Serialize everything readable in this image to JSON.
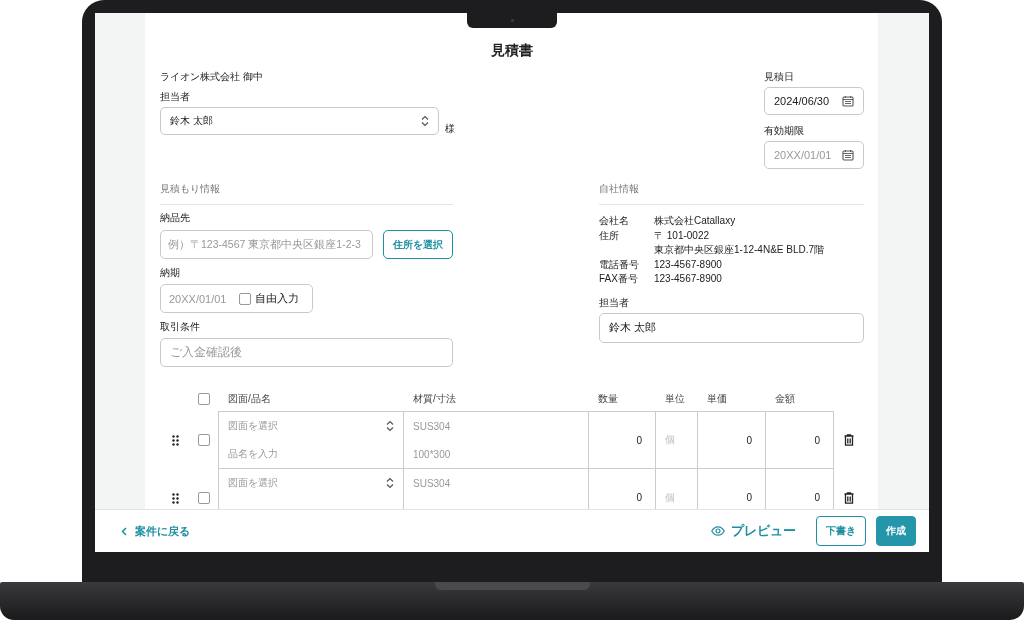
{
  "document": {
    "title": "見積書"
  },
  "client": {
    "name": "ライオン株式会社 御中",
    "contact_label": "担当者",
    "contact_value": "鈴木 太郎",
    "honorific": "様"
  },
  "dates": [
    {
      "label": "見積日",
      "value": "2024/06/30"
    },
    {
      "label": "有効期限",
      "placeholder": "20XX/01/01"
    }
  ],
  "estimate_info": {
    "heading": "見積もり情報",
    "delivery_address": {
      "label": "納品先",
      "placeholder": "例）〒123-4567 東京都中央区銀座1-2-3",
      "button": "住所を選択"
    },
    "due_date": {
      "label": "納期",
      "placeholder": "20XX/01/01",
      "checkbox_label": "自由入力",
      "checked": false
    },
    "terms": {
      "label": "取引条件",
      "placeholder": "ご入金確認後"
    }
  },
  "company_info": {
    "heading": "自社情報",
    "rows": [
      {
        "label": "会社名",
        "lines": [
          "株式会社Catallaxy"
        ]
      },
      {
        "label": "住所",
        "lines": [
          "〒 101-0022",
          "東京都中央区銀座1-12-4N&E BLD.7階"
        ]
      },
      {
        "label": "電話番号",
        "lines": [
          "123-4567-8900"
        ]
      },
      {
        "label": "FAX番号",
        "lines": [
          "123-4567-8900"
        ]
      }
    ],
    "contact_label": "担当者",
    "contact_value": "鈴木 太郎"
  },
  "items_table": {
    "select_all_checked": false,
    "columns": [
      "図面/品名",
      "材質/寸法",
      "数量",
      "単位",
      "単価",
      "金額"
    ],
    "rows": [
      {
        "checked": false,
        "drawing_placeholder": "図面を選択",
        "name_placeholder": "品名を入力",
        "material_placeholder": "SUS304",
        "size_placeholder": "100*300",
        "quantity": "0",
        "unit_placeholder": "個",
        "unit_price": "0",
        "amount": "0"
      },
      {
        "checked": false,
        "drawing_placeholder": "図面を選択",
        "material_placeholder": "SUS304",
        "quantity": "0",
        "unit_placeholder": "個",
        "unit_price": "0",
        "amount": "0"
      }
    ]
  },
  "footer": {
    "back_link": "案件に戻る",
    "preview": "プレビュー",
    "draft_button": "下書き",
    "create_button": "作成"
  }
}
